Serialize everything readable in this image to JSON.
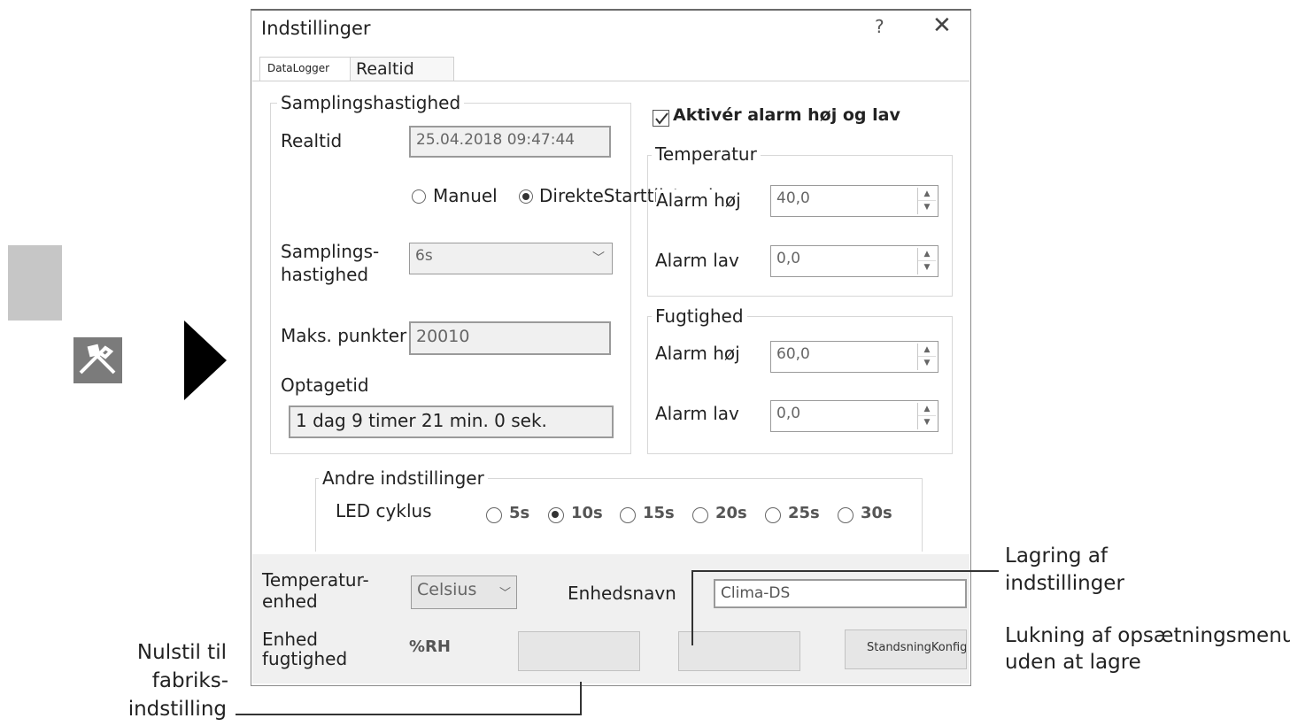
{
  "dialog": {
    "title": "Indstillinger",
    "help_glyph": "?",
    "close_glyph": "✕",
    "tabs": [
      "DataLogger",
      "Realtid"
    ]
  },
  "sampling": {
    "group_label": "Samplingshastighed",
    "realtime_label": "Realtid",
    "realtime_value": "25.04.2018 09:47:44",
    "radio_manual": "Manuel",
    "radio_direct": "DirekteStarttilstand",
    "rate_label_1": "Samplings-",
    "rate_label_2": "hastighed",
    "rate_value": "6s",
    "max_points_label": "Maks. punkter",
    "max_points_value": "20010",
    "duration_label": "Optagetid",
    "duration_value": "1 dag  9 timer  21 min.  0 sek."
  },
  "alarm": {
    "enable_label": "Aktivér alarm høj og lav",
    "temperature_label": "Temperatur",
    "temp_high_label": "Alarm høj",
    "temp_high_value": "40,0",
    "temp_low_label": "Alarm lav",
    "temp_low_value": "0,0",
    "humidity_label": "Fugtighed",
    "hum_high_label": "Alarm høj",
    "hum_high_value": "60,0",
    "hum_low_label": "Alarm lav",
    "hum_low_value": "0,0"
  },
  "other": {
    "group_label": "Andre indstillinger",
    "led_label": "LED cyklus",
    "options": [
      "5s",
      "10s",
      "15s",
      "20s",
      "25s",
      "30s"
    ],
    "selected": "10s"
  },
  "bottom": {
    "temp_unit_label_1": "Temperatur-",
    "temp_unit_label_2": "enhed",
    "temp_unit_value": "Celsius",
    "device_name_label": "Enhedsnavn",
    "device_name_value": "Clima-DS",
    "hum_unit_label_1": "Enhed",
    "hum_unit_label_2": "fugtighed",
    "hum_unit_value": "%RH",
    "btn_right_text": "StandsningKonfigureringNulstilling"
  },
  "callouts": {
    "save_1": "Lagring af",
    "save_2": "indstillinger",
    "close_1": "Lukning af opsætningsmenu",
    "close_2": "uden at lagre",
    "reset_1": "Nulstil til",
    "reset_2": "fabriks-",
    "reset_3": "indstilling"
  },
  "left_icons": {
    "tool_icon": "tools-icon",
    "arrow_icon": "arrow-right-icon"
  }
}
